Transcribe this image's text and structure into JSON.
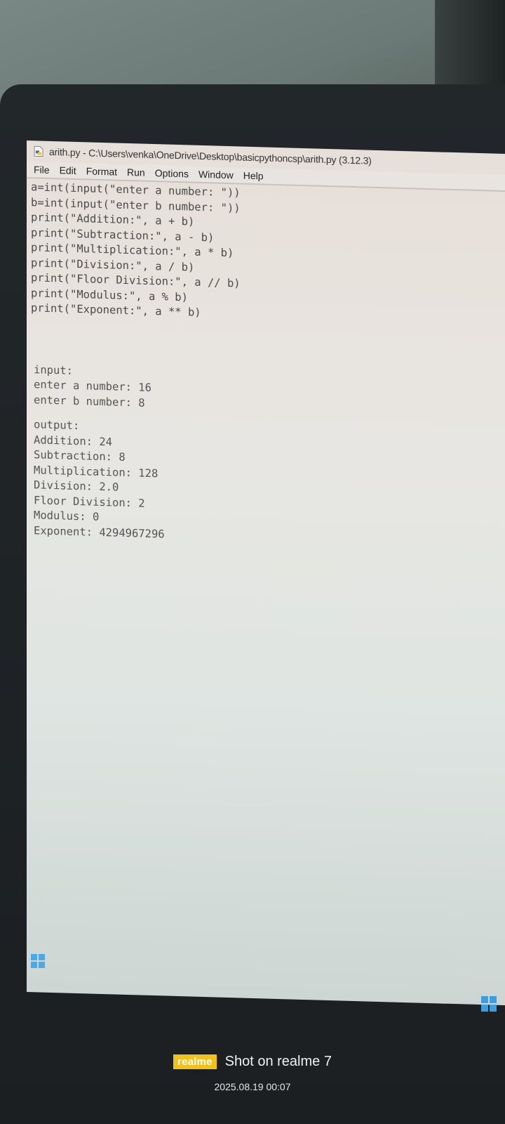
{
  "window": {
    "title": "arith.py - C:\\Users\\venka\\OneDrive\\Desktop\\basicpythoncsp\\arith.py (3.12.3)"
  },
  "menu": {
    "items": [
      "File",
      "Edit",
      "Format",
      "Run",
      "Options",
      "Window",
      "Help"
    ]
  },
  "code": {
    "lines": [
      "a=int(input(\"enter a number: \"))",
      "b=int(input(\"enter b number: \"))",
      "print(\"Addition:\", a + b)",
      "print(\"Subtraction:\", a - b)",
      "print(\"Multiplication:\", a * b)",
      "print(\"Division:\", a / b)",
      "print(\"Floor Division:\", a // b)",
      "print(\"Modulus:\", a % b)",
      "print(\"Exponent:\", a ** b)"
    ]
  },
  "input_section": {
    "header": "input:",
    "lines": [
      "enter a number: 16",
      "enter b number: 8"
    ]
  },
  "output_section": {
    "header": "output:",
    "lines": [
      "Addition: 24",
      "Subtraction: 8",
      "Multiplication: 128",
      "Division: 2.0",
      "Floor Division: 2",
      "Modulus: 0",
      "Exponent: 4294967296"
    ]
  },
  "watermark": {
    "brand": "realme",
    "text": "Shot on realme 7",
    "datetime": "2025.08.19 00:07"
  },
  "icons": {
    "app": "python-file-icon",
    "taskbar_left": "windows-icon",
    "taskbar_right": "windows-icon"
  },
  "colors": {
    "watermark_badge": "#f2c21a",
    "keyword": "#8a3f9a",
    "string": "#2c8a2c"
  }
}
